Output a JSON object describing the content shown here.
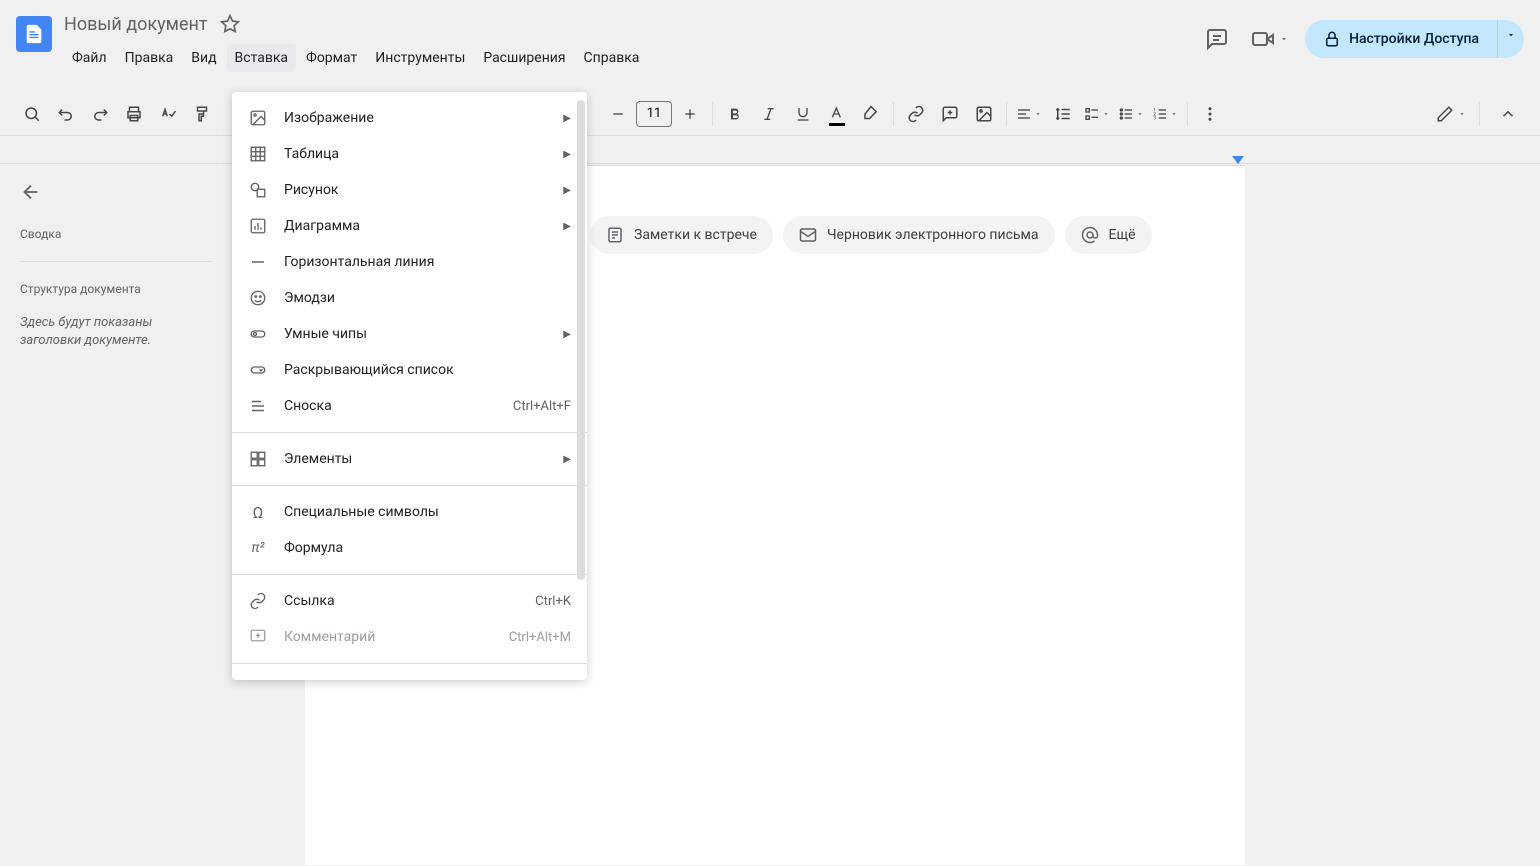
{
  "doc_title": "Новый документ",
  "menu": {
    "file": "Файл",
    "edit": "Правка",
    "view": "Вид",
    "insert": "Вставка",
    "format": "Формат",
    "tools": "Инструменты",
    "extensions": "Расширения",
    "help": "Справка"
  },
  "share_button": "Настройки Доступа",
  "toolbar": {
    "font_size": "11"
  },
  "sidebar": {
    "summary_heading": "Сводка",
    "outline_heading": "Структура документа",
    "outline_placeholder": "Здесь будут показаны заголовки документе."
  },
  "chips": {
    "meeting_notes": "Заметки к встрече",
    "email_draft": "Черновик электронного письма",
    "more": "Ещё"
  },
  "dropdown": {
    "image": "Изображение",
    "table": "Таблица",
    "drawing": "Рисунок",
    "chart": "Диаграмма",
    "horizontal_line": "Горизонтальная линия",
    "emoji": "Эмодзи",
    "smart_chips": "Умные чипы",
    "dropdown_list": "Раскрывающийся список",
    "footnote": "Сноска",
    "footnote_shortcut": "Ctrl+Alt+F",
    "building_blocks": "Элементы",
    "special_chars": "Специальные символы",
    "equation": "Формула",
    "link": "Ссылка",
    "link_shortcut": "Ctrl+K",
    "comment": "Комментарий",
    "comment_shortcut": "Ctrl+Alt+M"
  }
}
